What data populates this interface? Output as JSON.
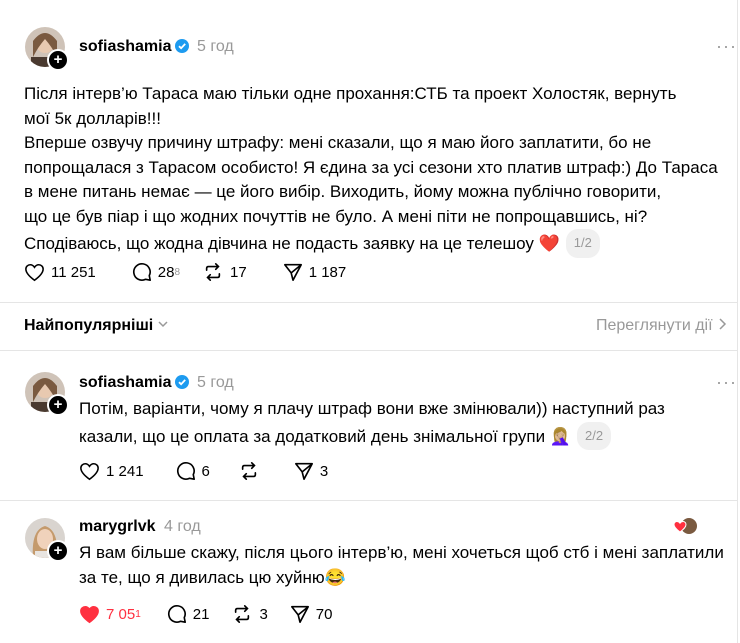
{
  "post": {
    "username": "sofiashamia",
    "time": "5 год",
    "text_lines": [
      "Після інтерв’ю Тараса маю тільки одне прохання:СТБ та проект Холостяк, вернуть",
      "мої 5к долларів!!!",
      "Вперше озвучу причину штрафу: мені сказали, що я маю його заплатити, бо не",
      "попрощалася з Тарасом особисто! Я єдина за усі сезони хто платив штраф:) До Тараса",
      "в мене питань немає — це його вибір. Виходить, йому можна публічно говорити,",
      "що це був піар і що жодних почуттів не було. А мені піти не попрощавшись, ні?",
      "Сподіваюсь, що жодна дівчина не подасть заявку на це телешоу ❤️"
    ],
    "pager": "1/2",
    "likes": "11 251",
    "comments": "28",
    "comments_sub": "8",
    "reposts": "17",
    "shares": "1 187"
  },
  "sort": {
    "label": "Найпопулярніші",
    "activity": "Переглянути дії"
  },
  "reply1": {
    "username": "sofiashamia",
    "time": "5 год",
    "text_lines": [
      "Потім, варіанти, чому я плачу штраф вони вже змінювали)) наступний раз",
      "казали, що це оплата за додатковий день знімальної групи 🤦🏼‍♀️"
    ],
    "pager": "2/2",
    "likes": "1 241",
    "comments": "6",
    "reposts": "",
    "shares": "3"
  },
  "reply2": {
    "username": "marygrlvk",
    "time": "4 год",
    "text_lines": [
      "Я вам більше скажу, після цього інтерв’ю, мені хочеться щоб стб і мені заплатили",
      "за те, що я дивилась цю хуйню😂"
    ],
    "likes": "7 05",
    "likes_sub": "1",
    "comments": "21",
    "reposts": "3",
    "shares": "70",
    "like_color": "#ff3040"
  }
}
